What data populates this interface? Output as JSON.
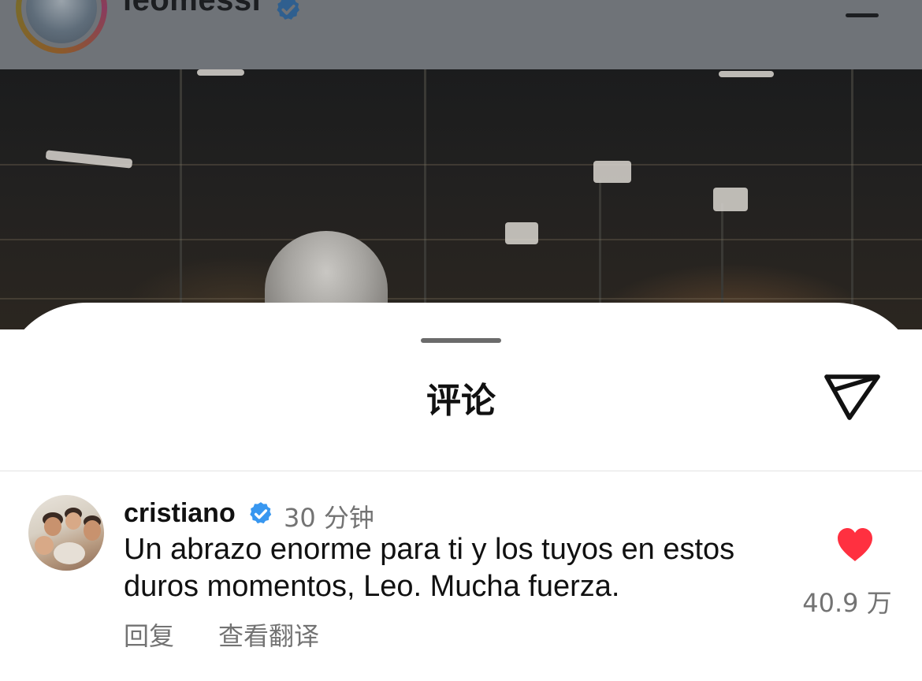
{
  "post": {
    "username": "leomessi",
    "verified_icon": "verified-badge-icon",
    "menu_icon": "hamburger-menu-icon"
  },
  "sheet": {
    "title": "评论",
    "share_icon": "send-icon"
  },
  "comment": {
    "username": "cristiano",
    "verified_icon": "verified-badge-icon",
    "time": "30 分钟",
    "text": "Un abrazo enorme para ti y los tuyos en estos duros momentos, Leo. Mucha fuerza.",
    "reply_label": "回复",
    "translate_label": "查看翻译",
    "like_icon": "heart-icon",
    "like_count": "40.9 万"
  },
  "colors": {
    "verified_blue": "#3897f0",
    "like_red": "#ff3040",
    "secondary_text": "#737373"
  }
}
